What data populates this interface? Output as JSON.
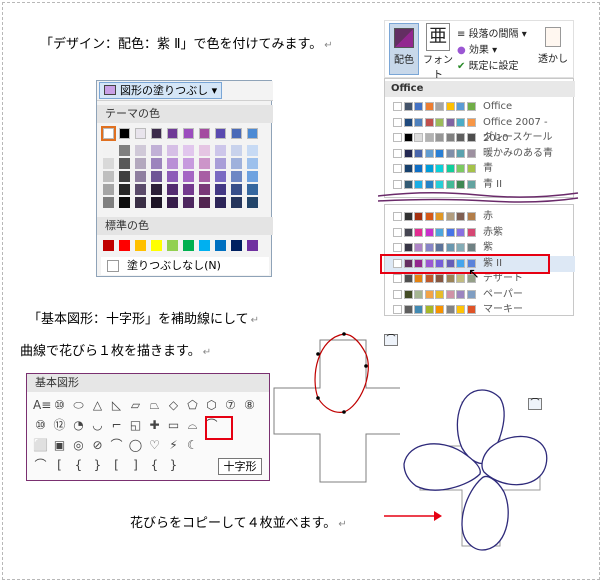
{
  "captions": {
    "line1": "「デザイン：配色：紫 Ⅱ」で色を付けてみます。",
    "line2a": "「基本図形：十字形」を補助線にして",
    "line2b": "曲線で花びら１枚を描きます。",
    "line3": "花びらをコピーして４枚並べます。"
  },
  "fill_panel": {
    "button_label": "図形の塗りつぶし",
    "theme_colors_label": "テーマの色",
    "standard_colors_label": "標準の色",
    "no_fill_label": "塗りつぶしなし(N)",
    "theme_top": [
      "#ffffff",
      "#000000",
      "#e8e4ec",
      "#3b2a4a",
      "#6f3a96",
      "#9b4dbe",
      "#a44ca0",
      "#5a4ab0",
      "#4a6ab8",
      "#4c8ad4"
    ],
    "theme_shades": [
      [
        "#f2f2f2",
        "#7f7f7f",
        "#d0c9d8",
        "#c1b0d6",
        "#d6bfe6",
        "#e1c6ed",
        "#e5c5e3",
        "#cdc6ea",
        "#c8d2ec",
        "#c7daf4"
      ],
      [
        "#d9d9d9",
        "#595959",
        "#b3a8be",
        "#9c84bd",
        "#b98fd6",
        "#c79ade",
        "#cc95c9",
        "#a99ed8",
        "#9fb1dc",
        "#9dc0ec"
      ],
      [
        "#bfbfbf",
        "#3f3f3f",
        "#8f7fa0",
        "#6f5596",
        "#8d5cb8",
        "#a566c4",
        "#a85ea4",
        "#7a6ac2",
        "#6d87c4",
        "#6ea2e0"
      ],
      [
        "#a5a5a5",
        "#262626",
        "#5a4a6a",
        "#2c1f38",
        "#532b70",
        "#74398e",
        "#7a3878",
        "#433884",
        "#374f8a",
        "#35679f"
      ],
      [
        "#7f7f7f",
        "#0c0c0c",
        "#3a2f45",
        "#1d1426",
        "#371d4a",
        "#4d265e",
        "#522550",
        "#2d2558",
        "#25355c",
        "#23456a"
      ]
    ],
    "standard": [
      "#c00000",
      "#ff0000",
      "#ffc000",
      "#ffff00",
      "#92d050",
      "#00b050",
      "#00b0f0",
      "#0070c0",
      "#002060",
      "#7030a0"
    ]
  },
  "ribbon": {
    "color_scheme_label": "配色",
    "font_label": "フォント",
    "spacing_label": "段落の間隔",
    "effects_label": "効果",
    "default_label": "既定に設定",
    "transparency_label": "透かし"
  },
  "theme_list": {
    "header": "Office",
    "items": [
      {
        "name": "Office",
        "colors": [
          "#ffffff",
          "#44546a",
          "#4472c4",
          "#ed7d31",
          "#a5a5a5",
          "#ffc000",
          "#5b9bd5",
          "#70ad47"
        ]
      },
      {
        "name": "Office 2007 - 2010",
        "colors": [
          "#ffffff",
          "#1f497d",
          "#4f81bd",
          "#c0504d",
          "#9bbb59",
          "#8064a2",
          "#4bacc6",
          "#f79646"
        ]
      },
      {
        "name": "グレースケール",
        "colors": [
          "#ffffff",
          "#000000",
          "#dddddd",
          "#b2b2b2",
          "#969696",
          "#808080",
          "#5f5f5f",
          "#4d4d4d"
        ]
      },
      {
        "name": "暖かみのある青",
        "colors": [
          "#ffffff",
          "#242852",
          "#4a66ac",
          "#629dd1",
          "#297fd5",
          "#7f8fa9",
          "#5aa2ae",
          "#9d90a0"
        ]
      },
      {
        "name": "青",
        "colors": [
          "#ffffff",
          "#17406d",
          "#0f6fc6",
          "#009dd9",
          "#0bd0d9",
          "#10cf9b",
          "#7cca62",
          "#a5c249"
        ]
      },
      {
        "name": "青 II",
        "colors": [
          "#ffffff",
          "#335b74",
          "#1cade4",
          "#2683c6",
          "#27ced7",
          "#42ba97",
          "#3e8853",
          "#62a39f"
        ]
      }
    ],
    "items2": [
      {
        "name": "赤",
        "colors": [
          "#ffffff",
          "#323232",
          "#a5300f",
          "#d55816",
          "#e19825",
          "#b19c7d",
          "#7f5f52",
          "#b27d49"
        ]
      },
      {
        "name": "赤紫",
        "colors": [
          "#ffffff",
          "#454551",
          "#e32d91",
          "#c830cc",
          "#4ea6dc",
          "#4775e7",
          "#8971e1",
          "#d54773"
        ]
      },
      {
        "name": "紫",
        "colors": [
          "#ffffff",
          "#373545",
          "#ad84c6",
          "#8784c7",
          "#5d739a",
          "#6997af",
          "#84acb6",
          "#6f8183"
        ]
      },
      {
        "name": "紫 II",
        "colors": [
          "#ffffff",
          "#632e62",
          "#92278f",
          "#9b57d3",
          "#755dd9",
          "#665eb8",
          "#45a5ed",
          "#5982db"
        ]
      },
      {
        "name": "デザート",
        "colors": [
          "#ffffff",
          "#4f4f4f",
          "#e48312",
          "#bd582c",
          "#865640",
          "#9b8357",
          "#c2bc80",
          "#94a088"
        ]
      },
      {
        "name": "ペーパー",
        "colors": [
          "#ffffff",
          "#444d26",
          "#a5b592",
          "#f3a447",
          "#e7bc29",
          "#d092a7",
          "#9c85c0",
          "#809ec2"
        ]
      },
      {
        "name": "マーキー",
        "colors": [
          "#ffffff",
          "#5e5e5e",
          "#418ab3",
          "#a6b727",
          "#f69200",
          "#838383",
          "#fec306",
          "#df5327"
        ]
      }
    ]
  },
  "shapes_panel": {
    "title": "基本図形",
    "tooltip": "十字形",
    "row1": [
      "A≡",
      "⑩",
      "⬭",
      "△",
      "◺",
      "▱",
      "⏢",
      "◇",
      "⬠",
      "⬡",
      "⑦",
      "⑧"
    ],
    "row2": [
      "⑩",
      "⑫",
      "◔",
      "◡",
      "⌐",
      "◱",
      "✚",
      "▭",
      "⌓",
      "⌒"
    ],
    "row3": [
      "⬜",
      "▣",
      "◎",
      "⊘",
      "⌒",
      "◯",
      "♡",
      "⚡",
      "☾"
    ],
    "row4": [
      "⌒",
      "[",
      "{",
      "}",
      "[",
      "]",
      "{",
      "}"
    ]
  }
}
